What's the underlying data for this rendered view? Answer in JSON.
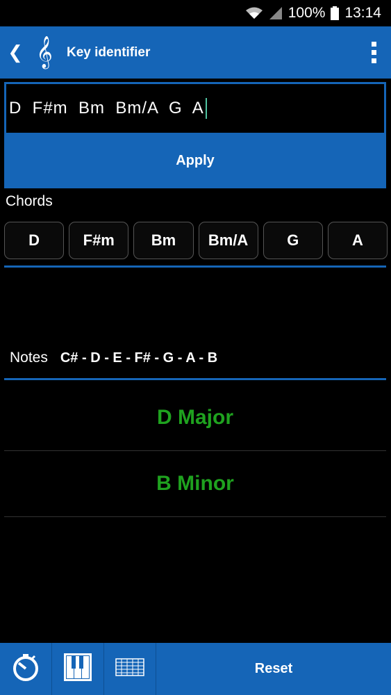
{
  "status": {
    "battery": "100%",
    "time": "13:14"
  },
  "appbar": {
    "title": "Key identifier",
    "back_icon": "chevron-left-icon",
    "app_icon": "treble-clef-icon",
    "menu_icon": "more-vert-icon"
  },
  "input": {
    "value": "D  F#m  Bm  Bm/A  G  A"
  },
  "apply": {
    "label": "Apply"
  },
  "chords": {
    "label": "Chords",
    "items": [
      "D",
      "F#m",
      "Bm",
      "Bm/A",
      "G",
      "A"
    ]
  },
  "notes": {
    "label": "Notes",
    "value": "C# - D - E - F# - G - A - B"
  },
  "keys": [
    "D Major",
    "B Minor"
  ],
  "bottom": {
    "reset_label": "Reset",
    "icons": [
      "metronome-icon",
      "piano-icon",
      "guitar-fretboard-icon"
    ]
  },
  "colors": {
    "accent": "#1565b7",
    "key_green": "#1fa21f"
  }
}
